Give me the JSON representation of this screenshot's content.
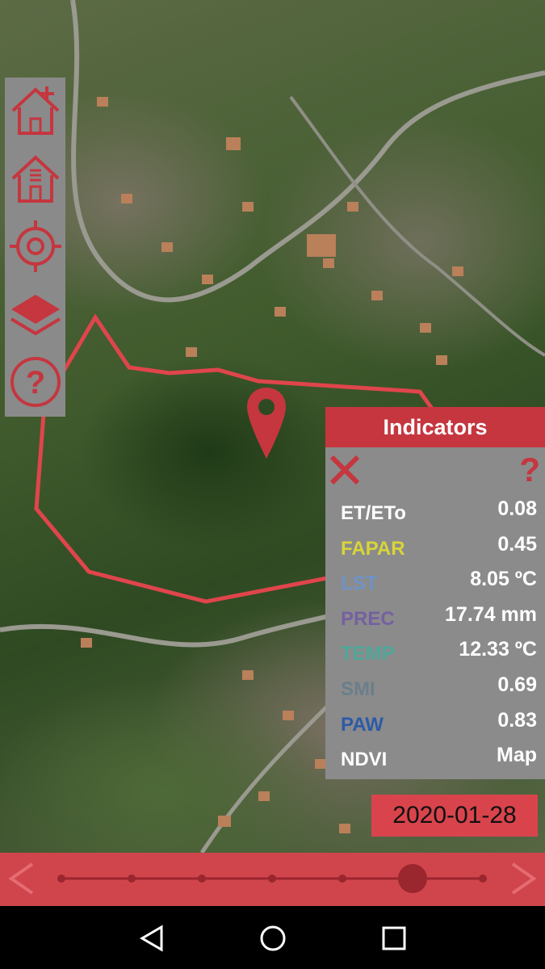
{
  "map": {
    "pin_icon": "map-pin-icon",
    "boundary_color": "#e0454c"
  },
  "sidebar": {
    "items": [
      {
        "icon": "home-add-icon"
      },
      {
        "icon": "home-list-icon"
      },
      {
        "icon": "crosshair-icon"
      },
      {
        "icon": "layers-icon"
      },
      {
        "icon": "help-circle-icon"
      }
    ]
  },
  "indicators": {
    "title": "Indicators",
    "help_label": "?",
    "rows": [
      {
        "label": "ET/ETo",
        "value": "0.08",
        "color": "#ffffff"
      },
      {
        "label": "FAPAR",
        "value": "0.45",
        "color": "#d8d43a"
      },
      {
        "label": "LST",
        "value": "8.05 ºC",
        "color": "#6f93c9"
      },
      {
        "label": "PREC",
        "value": "17.74 mm",
        "color": "#7560a2"
      },
      {
        "label": "TEMP",
        "value": "12.33 ºC",
        "color": "#4fa89a"
      },
      {
        "label": "SMI",
        "value": "0.69",
        "color": "#6a7e8a"
      },
      {
        "label": "PAW",
        "value": "0.83",
        "color": "#2d5aa8"
      },
      {
        "label": "NDVI",
        "value": "Map",
        "color": "#ffffff"
      }
    ]
  },
  "timeline": {
    "date": "2020-01-28",
    "steps": 7,
    "selected_index": 5
  },
  "system_nav": {
    "icons": [
      "back-icon",
      "home-icon",
      "recents-icon"
    ]
  },
  "colors": {
    "accent": "#c5363f",
    "panel_bg": "#8b8b8b",
    "timeline_bg": "#d0454c"
  }
}
